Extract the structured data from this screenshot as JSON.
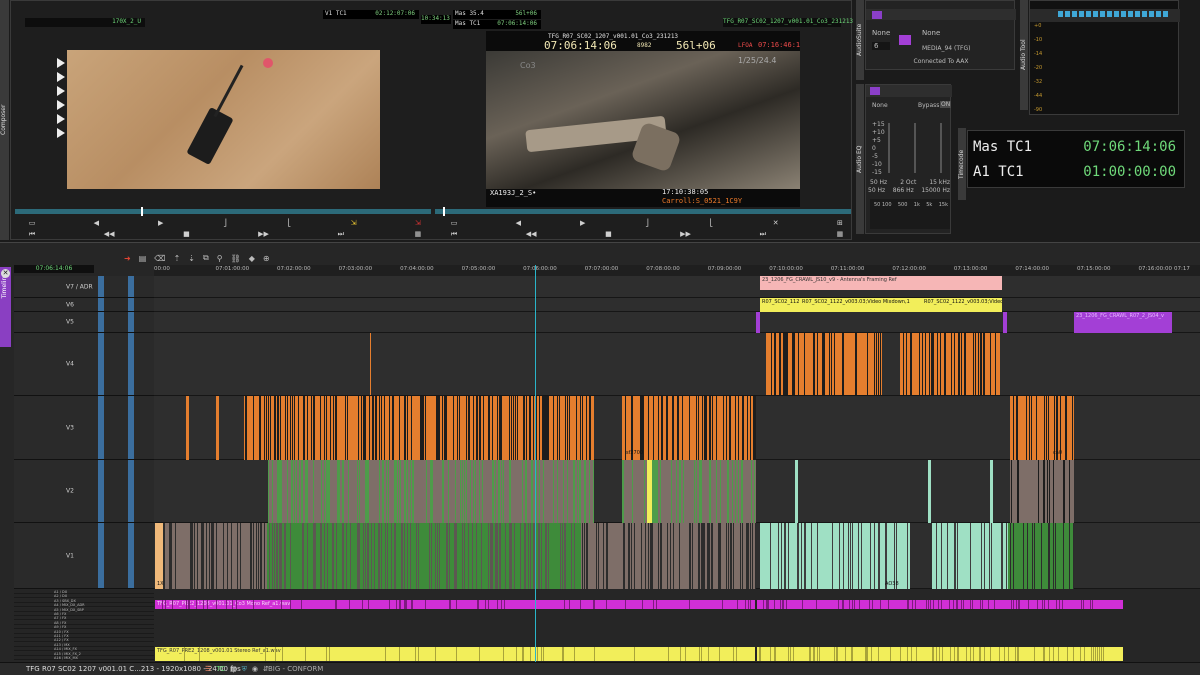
{
  "composer": {
    "tab": "Composer",
    "src_clip": "170X_2_U",
    "tc_v1_label": "V1 TC1",
    "tc_v1_value": "02:12:07:06",
    "tc_mid": "10:34:13",
    "tc_mas_label": "Mas 35.4",
    "tc_mas_value": "56l+06",
    "tc_mas2_label": "Mas TC1",
    "tc_mas2_value": "07:06:14:06",
    "record_clip": "TFG_R07_SC02_1207_v001.01_Co3_231213",
    "overlay_top": "TFG_R07_SC02_1207_v001.01_Co3_231213",
    "overlay_tc": "07:06:14:06",
    "overlay_frames": "8982",
    "overlay_feet": "56l+06",
    "overlay_lfoa_label": "LFOA",
    "overlay_lfoa": "07:16:46:18",
    "overlay_co": "Co3",
    "overlay_date": "1/25/24.4",
    "overlay_clipname": "XA193J_2_S•",
    "overlay_bottom_tc": "17:10:38:05",
    "overlay_bottom_name": "Carroll:S_0521_1C9Y"
  },
  "audio_suite": {
    "tab": "AudioSuite",
    "none1": "None",
    "ch": "6",
    "none2": "None",
    "media": "MEDIA_94 (TFG)",
    "status": "Connected To AAX"
  },
  "audio_tool": {
    "tab": "Audio Tool",
    "scale": [
      "+0",
      "-10",
      "-12",
      "-14",
      "-16",
      "-20",
      "-26",
      "-32",
      "-38",
      "-44",
      "-62",
      "-90"
    ]
  },
  "audio_eq": {
    "tab": "Audio EQ",
    "none": "None",
    "bypass": "Bypass",
    "on": "ON",
    "scale": [
      "+15",
      "+10",
      "+5",
      "0",
      "-5",
      "-10",
      "-15"
    ],
    "freq": [
      "50 Hz",
      "2 Oct",
      "15 kHz"
    ],
    "freq2": [
      "50 Hz",
      "866 Hz",
      "15000 Hz"
    ],
    "axis": [
      "50 100",
      "500",
      "1k",
      "5k",
      "15k"
    ]
  },
  "timecode": {
    "tab": "Timecode",
    "row1_label": "Mas TC1",
    "row1_value": "07:06:14:06",
    "row2_label": "A1 TC1",
    "row2_value": "01:00:00:00"
  },
  "timeline": {
    "tab": "Timeline",
    "current_tc": "07:06:14:06",
    "ruler": [
      "00:00",
      "07:01:00:00",
      "07:02:00:00",
      "07:03:00:00",
      "07:04:00:00",
      "07:05:00:00",
      "07:06:00:00",
      "07:07:00:00",
      "07:08:00:00",
      "07:09:00:00",
      "07:10:00:00",
      "07:11:00:00",
      "07:12:00:00",
      "07:13:00:00",
      "07:14:00:00",
      "07:15:00:00",
      "07:16:00:00",
      "07:17"
    ],
    "tracks": [
      "V7 / ADR",
      "V6",
      "V5",
      "V4",
      "V3",
      "V2",
      "V1"
    ],
    "audio_tracks": [
      "A1 / DX",
      "A2 / DX",
      "A3 / SBX_DX",
      "A4 / MIX_DX_ADR",
      "A5 / MIX_DX_SBP",
      "A6 / FX",
      "A7 / FX",
      "A8 / FX",
      "A9 / FX",
      "A10 / FX",
      "A11 / FX",
      "A12 / FX",
      "A13 / MX",
      "A14 / MIX_FX",
      "A15 / MIX_FX_2",
      "A16 / MIX_MX"
    ],
    "clip_ref": "23_1206_FG_CRAWL_JS10_v9 - Antenna's Framing Ref",
    "clip_v6_a": "R07_SC02_112",
    "clip_v6_b": "R07_SC02_1122_v003.03;Video Mixdown,1",
    "clip_v6_c": "R07_SC02_1122_v003.03;Video",
    "clip_v5": "23_1206_FG_CRAWL_R07_2_JS04_v",
    "clip_purple_audio": "TFG_R07_PRE2_1208_v001.01_Co3 Mono Ref_a1.wav",
    "clip_yellow_audio": "TFG_R07_PRE2_1208_v001.01 Stereo Ref_a1.wav",
    "v3_labels": [
      "sfE",
      "sf2700",
      "ca0"
    ],
    "v1_labels": [
      "1X",
      "17",
      "AO38",
      "1A"
    ],
    "footer_sequence": "TFG R07 SC02 1207 v001.01 C...213 - 1920x1080 - 24.00 fps",
    "footer_bin": "BIG - CONFORM"
  },
  "colors": {
    "accent_purple": "#a33fd6",
    "clip_orange": "#e57e2e",
    "clip_green": "#3e8b3a",
    "clip_taupe": "#7e6e68",
    "clip_mint": "#9fe0c4",
    "clip_yellow": "#f2ee5a",
    "clip_pink": "#f6b6b6",
    "clip_magenta": "#d02fd6",
    "playhead": "#2ab5c9",
    "track_blue": "#3b6e9e"
  }
}
